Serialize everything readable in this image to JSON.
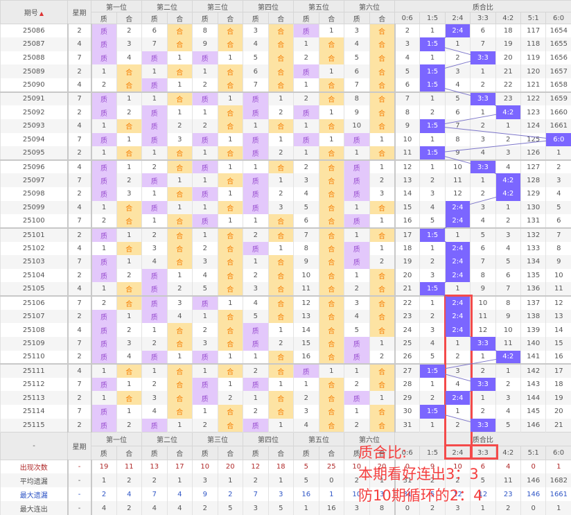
{
  "header": {
    "issue_label": "期号",
    "sort_icon": "sort-up-icon",
    "weekday_label": "星期",
    "positions": [
      "第一位",
      "第二位",
      "第三位",
      "第四位",
      "第五位",
      "第六位"
    ],
    "zhi": "质",
    "he": "合",
    "ratio_group": "质合比",
    "ratios": [
      "0:6",
      "1:5",
      "2:4",
      "3:3",
      "4:2",
      "5:1",
      "6:0"
    ]
  },
  "colors": {
    "zhi_bg": "#e3c8fb",
    "he_bg": "#fde3a3",
    "hit": "#7b66ff",
    "annotation": "#f43f3f"
  },
  "rows": [
    {
      "issue": "25086",
      "wd": "2",
      "p": [
        [
          "质",
          2
        ],
        [
          "合",
          6
        ],
        [
          "合",
          8
        ],
        [
          "合",
          3
        ],
        [
          "质",
          1
        ],
        [
          "合",
          3
        ]
      ],
      "r": [
        "2",
        "1",
        "2:4",
        "6",
        "18",
        "117",
        "1654"
      ]
    },
    {
      "issue": "25087",
      "wd": "4",
      "p": [
        [
          "质",
          3
        ],
        [
          "合",
          7
        ],
        [
          "合",
          9
        ],
        [
          "合",
          4
        ],
        [
          "合",
          1
        ],
        [
          "合",
          4
        ]
      ],
      "r": [
        "3",
        "1:5",
        "1",
        "7",
        "19",
        "118",
        "1655"
      ]
    },
    {
      "issue": "25088",
      "wd": "7",
      "p": [
        [
          "质",
          4
        ],
        [
          "质",
          1
        ],
        [
          "质",
          1
        ],
        [
          "合",
          5
        ],
        [
          "合",
          2
        ],
        [
          "合",
          5
        ]
      ],
      "r": [
        "4",
        "1",
        "2",
        "3:3",
        "20",
        "119",
        "1656"
      ]
    },
    {
      "issue": "25089",
      "wd": "2",
      "p": [
        [
          "合",
          1
        ],
        [
          "合",
          1
        ],
        [
          "合",
          1
        ],
        [
          "合",
          6
        ],
        [
          "质",
          1
        ],
        [
          "合",
          6
        ]
      ],
      "r": [
        "5",
        "1:5",
        "3",
        "1",
        "21",
        "120",
        "1657"
      ]
    },
    {
      "issue": "25090",
      "wd": "4",
      "p": [
        [
          "合",
          2
        ],
        [
          "质",
          1
        ],
        [
          "合",
          2
        ],
        [
          "合",
          7
        ],
        [
          "合",
          1
        ],
        [
          "合",
          7
        ]
      ],
      "r": [
        "6",
        "1:5",
        "4",
        "2",
        "22",
        "121",
        "1658"
      ]
    },
    {
      "issue": "25091",
      "wd": "7",
      "p": [
        [
          "质",
          1
        ],
        [
          "合",
          1
        ],
        [
          "质",
          1
        ],
        [
          "质",
          1
        ],
        [
          "合",
          2
        ],
        [
          "合",
          8
        ]
      ],
      "r": [
        "7",
        "1",
        "5",
        "3:3",
        "23",
        "122",
        "1659"
      ]
    },
    {
      "issue": "25092",
      "wd": "2",
      "p": [
        [
          "质",
          2
        ],
        [
          "质",
          1
        ],
        [
          "合",
          1
        ],
        [
          "质",
          2
        ],
        [
          "质",
          1
        ],
        [
          "合",
          9
        ]
      ],
      "r": [
        "8",
        "2",
        "6",
        "1",
        "4:2",
        "123",
        "1660"
      ]
    },
    {
      "issue": "25093",
      "wd": "4",
      "p": [
        [
          "合",
          1
        ],
        [
          "质",
          2
        ],
        [
          "合",
          2
        ],
        [
          "合",
          1
        ],
        [
          "合",
          1
        ],
        [
          "合",
          10
        ]
      ],
      "r": [
        "9",
        "1:5",
        "7",
        "2",
        "1",
        "124",
        "1661"
      ]
    },
    {
      "issue": "25094",
      "wd": "7",
      "p": [
        [
          "质",
          1
        ],
        [
          "质",
          3
        ],
        [
          "质",
          1
        ],
        [
          "质",
          1
        ],
        [
          "质",
          1
        ],
        [
          "质",
          1
        ]
      ],
      "r": [
        "10",
        "1",
        "8",
        "3",
        "2",
        "125",
        "6:0"
      ]
    },
    {
      "issue": "25095",
      "wd": "2",
      "p": [
        [
          "合",
          1
        ],
        [
          "合",
          1
        ],
        [
          "合",
          1
        ],
        [
          "质",
          2
        ],
        [
          "合",
          1
        ],
        [
          "合",
          1
        ]
      ],
      "r": [
        "11",
        "1:5",
        "9",
        "4",
        "3",
        "126",
        "1"
      ]
    },
    {
      "issue": "25096",
      "wd": "4",
      "p": [
        [
          "质",
          1
        ],
        [
          "合",
          2
        ],
        [
          "质",
          1
        ],
        [
          "合",
          1
        ],
        [
          "合",
          2
        ],
        [
          "质",
          1
        ]
      ],
      "r": [
        "12",
        "1",
        "10",
        "3:3",
        "4",
        "127",
        "2"
      ]
    },
    {
      "issue": "25097",
      "wd": "7",
      "p": [
        [
          "质",
          2
        ],
        [
          "质",
          1
        ],
        [
          "合",
          1
        ],
        [
          "质",
          1
        ],
        [
          "合",
          3
        ],
        [
          "质",
          2
        ]
      ],
      "r": [
        "13",
        "2",
        "11",
        "1",
        "4:2",
        "128",
        "3"
      ]
    },
    {
      "issue": "25098",
      "wd": "2",
      "p": [
        [
          "质",
          3
        ],
        [
          "合",
          1
        ],
        [
          "质",
          1
        ],
        [
          "质",
          2
        ],
        [
          "合",
          4
        ],
        [
          "质",
          3
        ]
      ],
      "r": [
        "14",
        "3",
        "12",
        "2",
        "4:2",
        "129",
        "4"
      ]
    },
    {
      "issue": "25099",
      "wd": "4",
      "p": [
        [
          "合",
          1
        ],
        [
          "质",
          1
        ],
        [
          "合",
          1
        ],
        [
          "质",
          3
        ],
        [
          "合",
          5
        ],
        [
          "合",
          1
        ]
      ],
      "r": [
        "15",
        "4",
        "2:4",
        "3",
        "1",
        "130",
        "5"
      ]
    },
    {
      "issue": "25100",
      "wd": "7",
      "p": [
        [
          "合",
          2
        ],
        [
          "合",
          1
        ],
        [
          "质",
          1
        ],
        [
          "合",
          1
        ],
        [
          "合",
          6
        ],
        [
          "质",
          1
        ]
      ],
      "r": [
        "16",
        "5",
        "2:4",
        "4",
        "2",
        "131",
        "6"
      ]
    },
    {
      "issue": "25101",
      "wd": "2",
      "p": [
        [
          "质",
          1
        ],
        [
          "合",
          2
        ],
        [
          "合",
          1
        ],
        [
          "合",
          2
        ],
        [
          "合",
          7
        ],
        [
          "合",
          1
        ]
      ],
      "r": [
        "17",
        "1:5",
        "1",
        "5",
        "3",
        "132",
        "7"
      ]
    },
    {
      "issue": "25102",
      "wd": "4",
      "p": [
        [
          "合",
          1
        ],
        [
          "合",
          3
        ],
        [
          "合",
          2
        ],
        [
          "质",
          1
        ],
        [
          "合",
          8
        ],
        [
          "质",
          1
        ]
      ],
      "r": [
        "18",
        "1",
        "2:4",
        "6",
        "4",
        "133",
        "8"
      ]
    },
    {
      "issue": "25103",
      "wd": "7",
      "p": [
        [
          "质",
          1
        ],
        [
          "合",
          4
        ],
        [
          "合",
          3
        ],
        [
          "合",
          1
        ],
        [
          "合",
          9
        ],
        [
          "质",
          2
        ]
      ],
      "r": [
        "19",
        "2",
        "2:4",
        "7",
        "5",
        "134",
        "9"
      ]
    },
    {
      "issue": "25104",
      "wd": "2",
      "p": [
        [
          "质",
          2
        ],
        [
          "质",
          1
        ],
        [
          "合",
          4
        ],
        [
          "合",
          2
        ],
        [
          "合",
          10
        ],
        [
          "合",
          1
        ]
      ],
      "r": [
        "20",
        "3",
        "2:4",
        "8",
        "6",
        "135",
        "10"
      ]
    },
    {
      "issue": "25105",
      "wd": "4",
      "p": [
        [
          "合",
          1
        ],
        [
          "质",
          2
        ],
        [
          "合",
          5
        ],
        [
          "合",
          3
        ],
        [
          "合",
          11
        ],
        [
          "合",
          2
        ]
      ],
      "r": [
        "21",
        "1:5",
        "1",
        "9",
        "7",
        "136",
        "11"
      ]
    },
    {
      "issue": "25106",
      "wd": "7",
      "p": [
        [
          "合",
          2
        ],
        [
          "质",
          3
        ],
        [
          "质",
          1
        ],
        [
          "合",
          4
        ],
        [
          "合",
          12
        ],
        [
          "合",
          3
        ]
      ],
      "r": [
        "22",
        "1",
        "2:4",
        "10",
        "8",
        "137",
        "12"
      ]
    },
    {
      "issue": "25107",
      "wd": "2",
      "p": [
        [
          "质",
          1
        ],
        [
          "质",
          4
        ],
        [
          "合",
          1
        ],
        [
          "合",
          5
        ],
        [
          "合",
          13
        ],
        [
          "合",
          4
        ]
      ],
      "r": [
        "23",
        "2",
        "2:4",
        "11",
        "9",
        "138",
        "13"
      ]
    },
    {
      "issue": "25108",
      "wd": "4",
      "p": [
        [
          "质",
          2
        ],
        [
          "合",
          1
        ],
        [
          "合",
          2
        ],
        [
          "质",
          1
        ],
        [
          "合",
          14
        ],
        [
          "合",
          5
        ]
      ],
      "r": [
        "24",
        "3",
        "2:4",
        "12",
        "10",
        "139",
        "14"
      ]
    },
    {
      "issue": "25109",
      "wd": "7",
      "p": [
        [
          "质",
          3
        ],
        [
          "合",
          2
        ],
        [
          "合",
          3
        ],
        [
          "质",
          2
        ],
        [
          "合",
          15
        ],
        [
          "质",
          1
        ]
      ],
      "r": [
        "25",
        "4",
        "1",
        "3:3",
        "11",
        "140",
        "15"
      ]
    },
    {
      "issue": "25110",
      "wd": "2",
      "p": [
        [
          "质",
          4
        ],
        [
          "质",
          1
        ],
        [
          "质",
          1
        ],
        [
          "合",
          1
        ],
        [
          "合",
          16
        ],
        [
          "质",
          2
        ]
      ],
      "r": [
        "26",
        "5",
        "2",
        "1",
        "4:2",
        "141",
        "16"
      ]
    },
    {
      "issue": "25111",
      "wd": "4",
      "p": [
        [
          "合",
          1
        ],
        [
          "合",
          1
        ],
        [
          "合",
          1
        ],
        [
          "合",
          2
        ],
        [
          "质",
          1
        ],
        [
          "合",
          1
        ]
      ],
      "r": [
        "27",
        "1:5",
        "3",
        "2",
        "1",
        "142",
        "17"
      ]
    },
    {
      "issue": "25112",
      "wd": "7",
      "p": [
        [
          "质",
          1
        ],
        [
          "合",
          2
        ],
        [
          "质",
          1
        ],
        [
          "质",
          1
        ],
        [
          "合",
          1
        ],
        [
          "合",
          2
        ]
      ],
      "r": [
        "28",
        "1",
        "4",
        "3:3",
        "2",
        "143",
        "18"
      ]
    },
    {
      "issue": "25113",
      "wd": "2",
      "p": [
        [
          "合",
          1
        ],
        [
          "合",
          3
        ],
        [
          "质",
          2
        ],
        [
          "合",
          1
        ],
        [
          "合",
          2
        ],
        [
          "质",
          1
        ]
      ],
      "r": [
        "29",
        "2",
        "2:4",
        "1",
        "3",
        "144",
        "19"
      ]
    },
    {
      "issue": "25114",
      "wd": "7",
      "p": [
        [
          "质",
          1
        ],
        [
          "合",
          4
        ],
        [
          "合",
          1
        ],
        [
          "合",
          2
        ],
        [
          "合",
          3
        ],
        [
          "合",
          1
        ]
      ],
      "r": [
        "30",
        "1:5",
        "1",
        "2",
        "4",
        "145",
        "20"
      ]
    },
    {
      "issue": "25115",
      "wd": "2",
      "p": [
        [
          "质",
          2
        ],
        [
          "质",
          1
        ],
        [
          "合",
          2
        ],
        [
          "质",
          1
        ],
        [
          "合",
          4
        ],
        [
          "合",
          2
        ]
      ],
      "r": [
        "31",
        "1",
        "2",
        "3:3",
        "5",
        "146",
        "21"
      ]
    }
  ],
  "footer": {
    "dash": "-",
    "weekday_label": "星期",
    "stats": [
      {
        "label": "出现次数",
        "cls": "r-cnt",
        "wd": "-",
        "v": [
          "19",
          "11",
          "13",
          "17",
          "10",
          "20",
          "12",
          "18",
          "5",
          "25",
          "10",
          "20",
          "0",
          "9",
          "10",
          "6",
          "4",
          "0",
          "1"
        ]
      },
      {
        "label": "平均遗漏",
        "cls": "r-avg",
        "wd": "-",
        "v": [
          "1",
          "2",
          "2",
          "1",
          "3",
          "1",
          "2",
          "1",
          "5",
          "0",
          "2",
          "1",
          "31",
          "2",
          "2",
          "5",
          "11",
          "146",
          "1682"
        ]
      },
      {
        "label": "最大遗漏",
        "cls": "r-max",
        "wd": "-",
        "v": [
          "2",
          "4",
          "7",
          "4",
          "9",
          "2",
          "7",
          "3",
          "16",
          "1",
          "10",
          "3",
          "31",
          "5",
          "12",
          "12",
          "23",
          "146",
          "1661"
        ]
      },
      {
        "label": "最大连出",
        "cls": "r-run",
        "wd": "-",
        "v": [
          "4",
          "2",
          "4",
          "4",
          "2",
          "5",
          "3",
          "5",
          "1",
          "16",
          "3",
          "8",
          "0",
          "2",
          "3",
          "1",
          "2",
          "0",
          "1"
        ]
      }
    ]
  },
  "annotation": {
    "line1": "质合比:",
    "line2": "本期看好连出3：3",
    "line3": "防10期循环的2：4"
  }
}
